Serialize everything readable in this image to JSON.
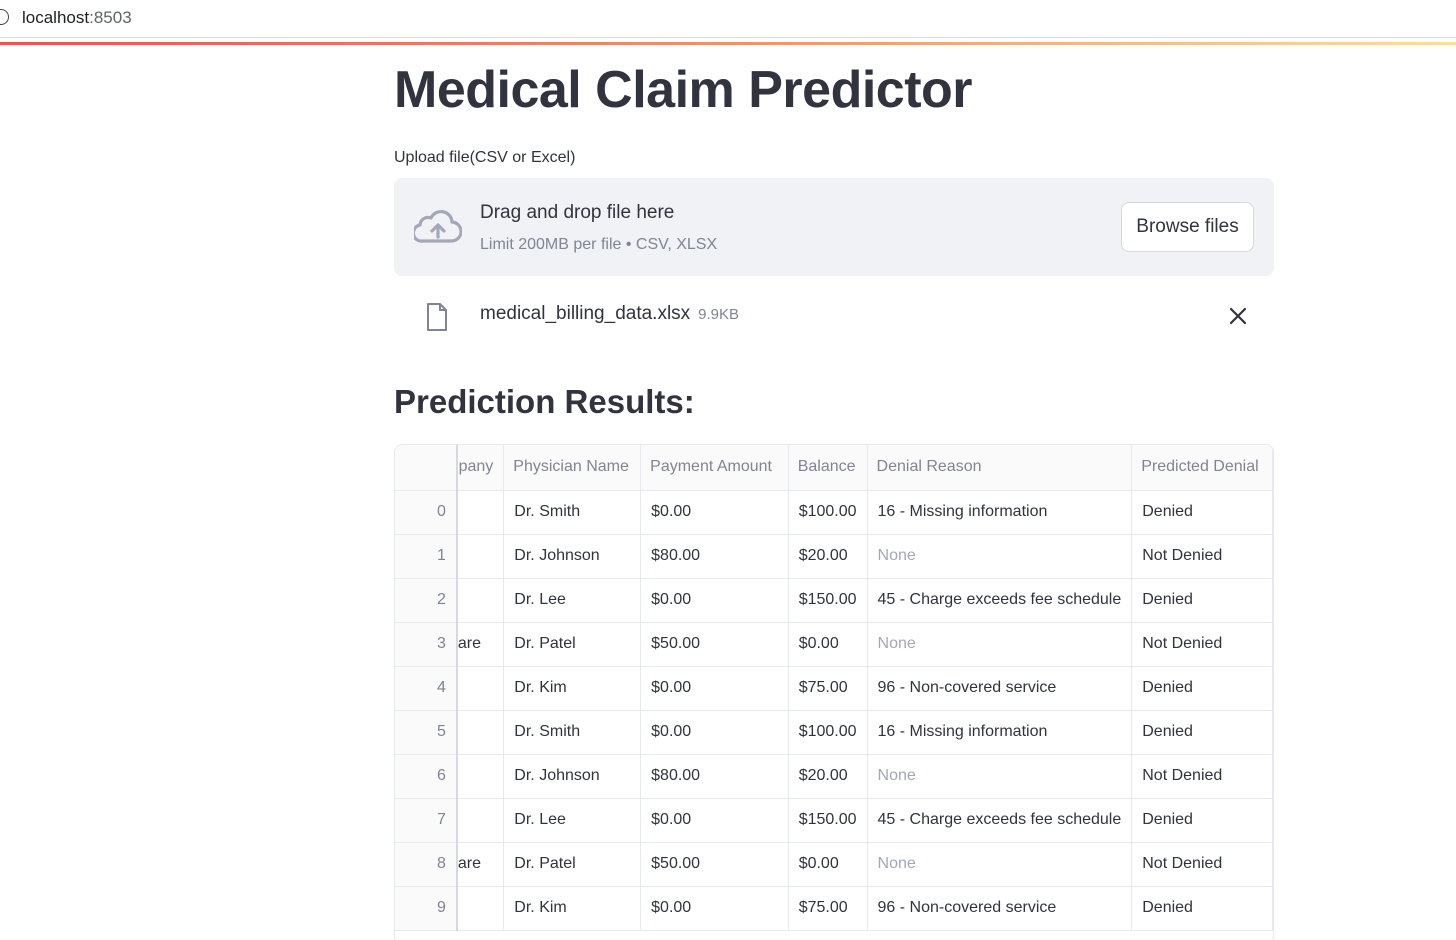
{
  "browser": {
    "host": "localhost",
    "port": ":8503"
  },
  "page": {
    "title": "Medical Claim Predictor",
    "upload_label": "Upload file(CSV or Excel)",
    "dropzone": {
      "title": "Drag and drop file here",
      "subtitle": "Limit 200MB per file • CSV, XLSX",
      "button": "Browse files",
      "icon": "cloud-upload-icon"
    },
    "file": {
      "name": "medical_billing_data.xlsx",
      "size": "9.9KB",
      "icon": "file-icon"
    },
    "results_title": "Prediction Results:"
  },
  "table": {
    "columns": [
      "",
      "pany",
      "Physician Name",
      "Payment Amount",
      "Balance",
      "Denial Reason",
      "Predicted Denial"
    ],
    "rows": [
      [
        "0",
        "",
        "Dr. Smith",
        "$0.00",
        "$100.00",
        "16 - Missing information",
        "Denied"
      ],
      [
        "1",
        "",
        "Dr. Johnson",
        "$80.00",
        "$20.00",
        "None",
        "Not Denied"
      ],
      [
        "2",
        "",
        "Dr. Lee",
        "$0.00",
        "$150.00",
        "45 - Charge exceeds fee schedule",
        "Denied"
      ],
      [
        "3",
        "are",
        "Dr. Patel",
        "$50.00",
        "$0.00",
        "None",
        "Not Denied"
      ],
      [
        "4",
        "",
        "Dr. Kim",
        "$0.00",
        "$75.00",
        "96 - Non-covered service",
        "Denied"
      ],
      [
        "5",
        "",
        "Dr. Smith",
        "$0.00",
        "$100.00",
        "16 - Missing information",
        "Denied"
      ],
      [
        "6",
        "",
        "Dr. Johnson",
        "$80.00",
        "$20.00",
        "None",
        "Not Denied"
      ],
      [
        "7",
        "",
        "Dr. Lee",
        "$0.00",
        "$150.00",
        "45 - Charge exceeds fee schedule",
        "Denied"
      ],
      [
        "8",
        "are",
        "Dr. Patel",
        "$50.00",
        "$0.00",
        "None",
        "Not Denied"
      ],
      [
        "9",
        "",
        "Dr. Kim",
        "$0.00",
        "$75.00",
        "96 - Non-covered service",
        "Denied"
      ]
    ]
  },
  "colors": {
    "accent": "#ff4b4b",
    "text": "#31333f",
    "muted": "#808495",
    "dropzone_bg": "#f0f2f6"
  }
}
